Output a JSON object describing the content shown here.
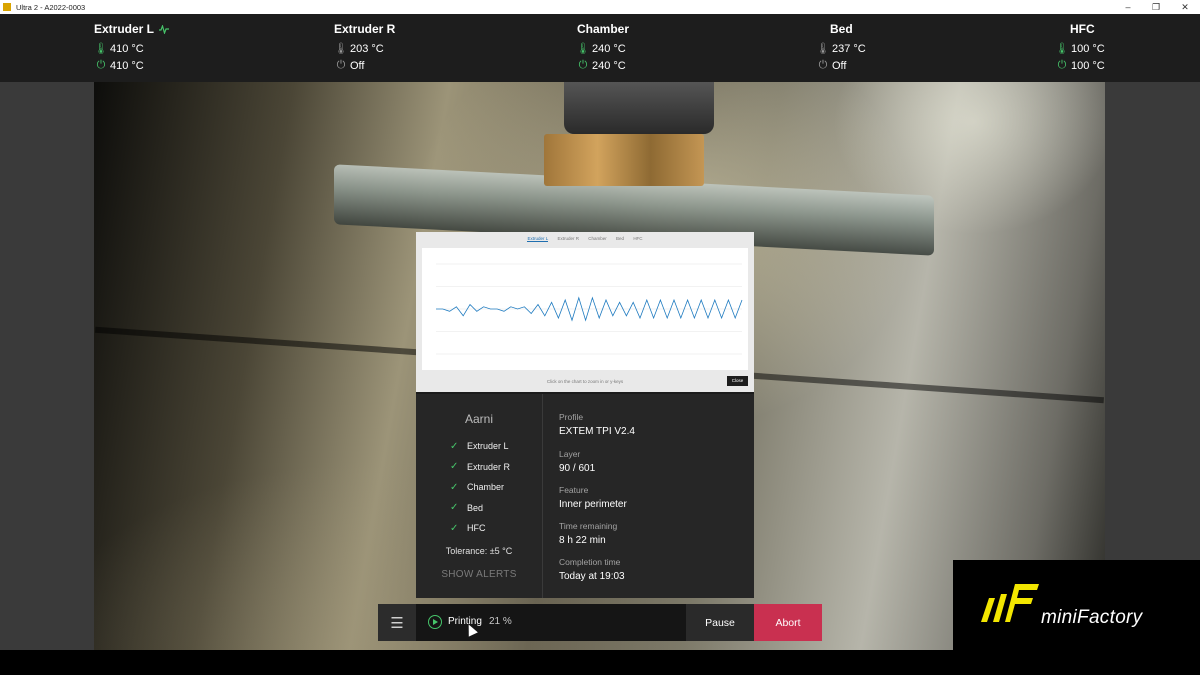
{
  "window": {
    "title": "Ultra 2 - A2022-0003",
    "minimize": "–",
    "restore": "❐",
    "close": "✕"
  },
  "heaters": [
    {
      "name": "Extruder L",
      "current": "410 °C",
      "target": "410 °C",
      "active": true,
      "activity_icon": "activity-icon"
    },
    {
      "name": "Extruder R",
      "current": "203 °C",
      "target": "Off",
      "active": false
    },
    {
      "name": "Chamber",
      "current": "240 °C",
      "target": "240 °C",
      "active": true
    },
    {
      "name": "Bed",
      "current": "237 °C",
      "target": "Off",
      "active": false
    },
    {
      "name": "HFC",
      "current": "100 °C",
      "target": "100 °C",
      "active": true
    }
  ],
  "chart": {
    "tabs": [
      "Extruder L",
      "Extruder R",
      "Chamber",
      "Bed",
      "HFC"
    ],
    "active_tab": "Extruder L",
    "hint": "Click on the chart to zoom in or y-keys",
    "close_label": "Close"
  },
  "chart_data": {
    "type": "line",
    "series": [
      {
        "values": [
          415,
          415,
          414,
          416,
          412,
          417,
          414,
          416,
          415,
          415,
          414,
          416,
          415,
          416,
          413,
          417,
          412,
          418,
          411,
          419,
          410,
          420,
          410,
          420,
          411,
          419,
          412,
          418,
          412,
          418,
          411,
          419,
          411,
          419,
          411,
          419,
          411,
          419,
          411,
          419,
          411,
          419,
          411,
          419,
          411,
          419
        ]
      }
    ],
    "color": "#1f7bc0"
  },
  "panel": {
    "name": "Aarni",
    "checks": [
      "Extruder L",
      "Extruder R",
      "Chamber",
      "Bed",
      "HFC"
    ],
    "tolerance": "Tolerance: ±5 °C",
    "show_alerts": "SHOW ALERTS",
    "info": [
      {
        "label": "Profile",
        "value": "EXTEM TPI V2.4"
      },
      {
        "label": "Layer",
        "value": "90 / 601"
      },
      {
        "label": "Feature",
        "value": "Inner perimeter"
      },
      {
        "label": "Time remaining",
        "value": "8 h 22 min"
      },
      {
        "label": "Completion time",
        "value": "Today at 19:03"
      }
    ]
  },
  "controls": {
    "menu_icon": "☰",
    "state": "Printing",
    "progress": "21 %",
    "pause_label": "Pause",
    "abort_label": "Abort"
  },
  "logo": {
    "text": "miniFactory"
  },
  "colors": {
    "accent_green": "#46c46a",
    "abort_red": "#c93050",
    "logo_yellow": "#f2e600"
  }
}
